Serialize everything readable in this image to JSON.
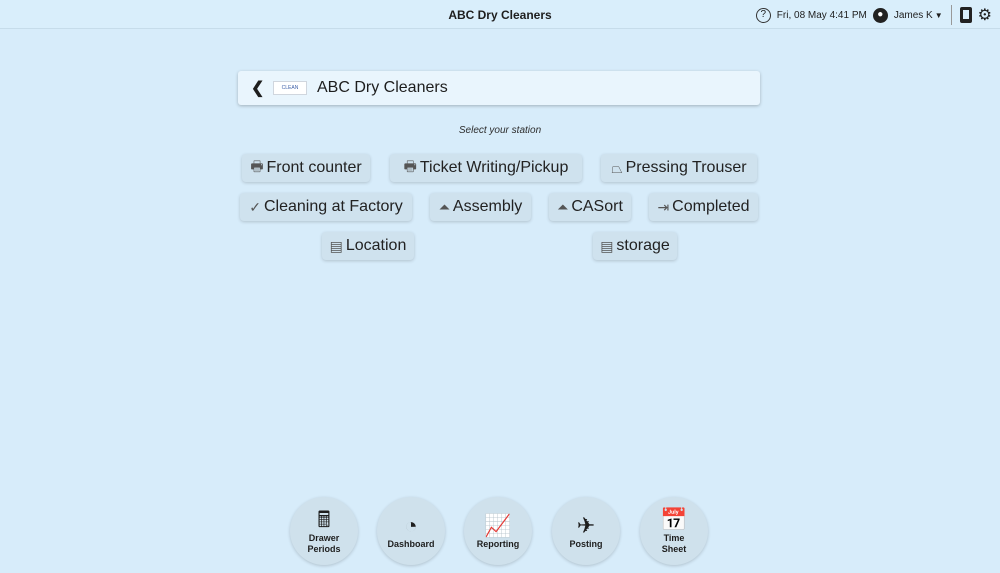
{
  "topbar": {
    "title": "ABC Dry Cleaners",
    "datetime": "Fri, 08 May 4:41 PM",
    "user": "James K",
    "icons": {
      "help": "help-icon",
      "user": "user-icon",
      "device": "tablet-icon",
      "settings": "gear-icon"
    }
  },
  "header": {
    "title": "ABC Dry Cleaners",
    "logo_text": "CLEAN"
  },
  "subtitle": "Select your station",
  "stations": [
    {
      "label": "Front counter",
      "icon": "register-icon"
    },
    {
      "label": "Ticket Writing/Pickup",
      "icon": "register-icon"
    },
    {
      "label": "Pressing Trouser",
      "icon": "iron-icon"
    },
    {
      "label": "Cleaning at Factory",
      "icon": "check-circle-icon"
    },
    {
      "label": "Assembly",
      "icon": "hanger-icon"
    },
    {
      "label": "CASort",
      "icon": "hanger-icon"
    },
    {
      "label": "Completed",
      "icon": "exit-icon"
    },
    {
      "label": "Location",
      "icon": "box-icon"
    },
    {
      "label": "storage",
      "icon": "box-icon"
    }
  ],
  "bottom": {
    "drawer": "Drawer Periods",
    "dashboard": "Dashboard",
    "reporting": "Reporting",
    "posting": "Posting",
    "timesheet": "Time Sheet"
  }
}
